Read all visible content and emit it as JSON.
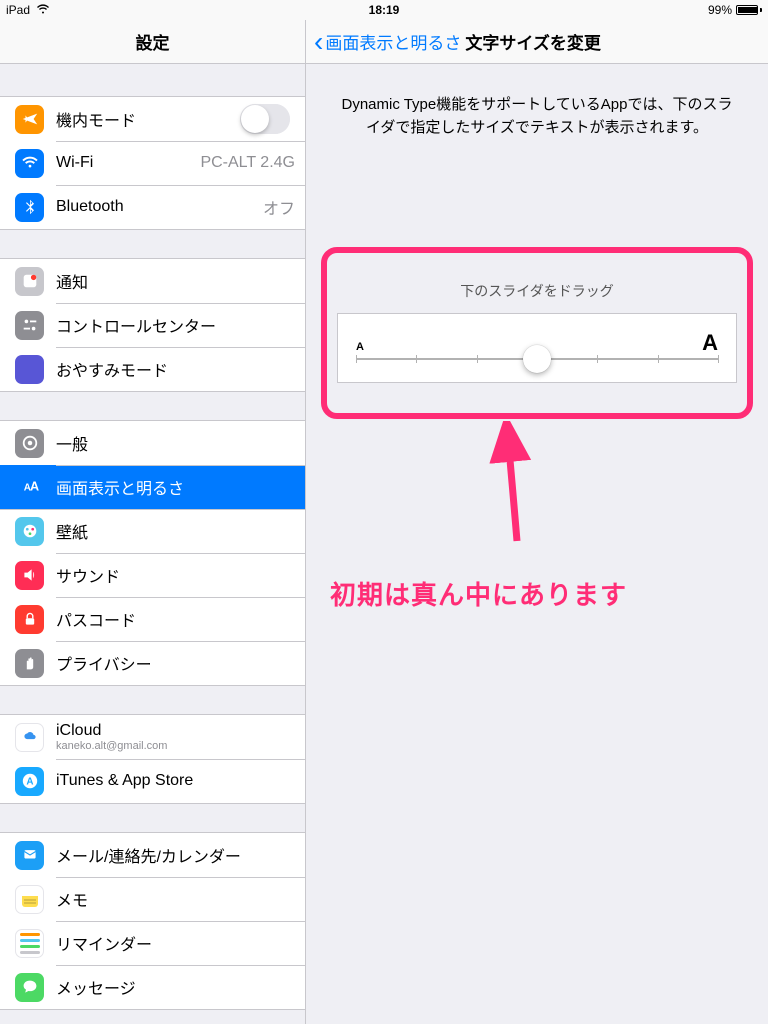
{
  "status": {
    "carrier": "iPad",
    "time": "18:19",
    "battery": "99%"
  },
  "sidebar": {
    "title": "設定",
    "groups": [
      [
        {
          "label": "機内モード",
          "icon": "airplane",
          "color": "#ff9500",
          "toggle": true
        },
        {
          "label": "Wi-Fi",
          "icon": "wifi",
          "color": "#007aff",
          "value": "PC-ALT 2.4G"
        },
        {
          "label": "Bluetooth",
          "icon": "bluetooth",
          "color": "#007aff",
          "value": "オフ"
        }
      ],
      [
        {
          "label": "通知",
          "icon": "notify",
          "color": "#c7c7cc"
        },
        {
          "label": "コントロールセンター",
          "icon": "control",
          "color": "#8e8e93"
        },
        {
          "label": "おやすみモード",
          "icon": "moon",
          "color": "#5856d6"
        }
      ],
      [
        {
          "label": "一般",
          "icon": "gear",
          "color": "#8e8e93"
        },
        {
          "label": "画面表示と明るさ",
          "icon": "aa",
          "color": "#007aff",
          "selected": true
        },
        {
          "label": "壁紙",
          "icon": "wallpaper",
          "color": "#54c7ec"
        },
        {
          "label": "サウンド",
          "icon": "sound",
          "color": "#ff2d55"
        },
        {
          "label": "パスコード",
          "icon": "lock",
          "color": "#ff3b30"
        },
        {
          "label": "プライバシー",
          "icon": "hand",
          "color": "#8e8e93"
        }
      ],
      [
        {
          "label": "iCloud",
          "icon": "cloud",
          "color": "#fff",
          "sub": "kaneko.alt@gmail.com"
        },
        {
          "label": "iTunes & App Store",
          "icon": "appstore",
          "color": "#18a9ff"
        }
      ],
      [
        {
          "label": "メール/連絡先/カレンダー",
          "icon": "mail",
          "color": "#1c9ff6"
        },
        {
          "label": "メモ",
          "icon": "notes",
          "color": "#fff"
        },
        {
          "label": "リマインダー",
          "icon": "reminders",
          "color": "#fff"
        },
        {
          "label": "メッセージ",
          "icon": "message",
          "color": "#4cd964"
        }
      ]
    ]
  },
  "detail": {
    "back": "画面表示と明るさ",
    "title": "文字サイズを変更",
    "description": "Dynamic Type機能をサポートしているAppでは、下のスライダで指定したサイズでテキストが表示されます。",
    "sliderLabel": "下のスライダをドラッグ",
    "smallA": "A",
    "bigA": "A",
    "sliderPos": 50
  },
  "annotation": "初期は真ん中にあります"
}
